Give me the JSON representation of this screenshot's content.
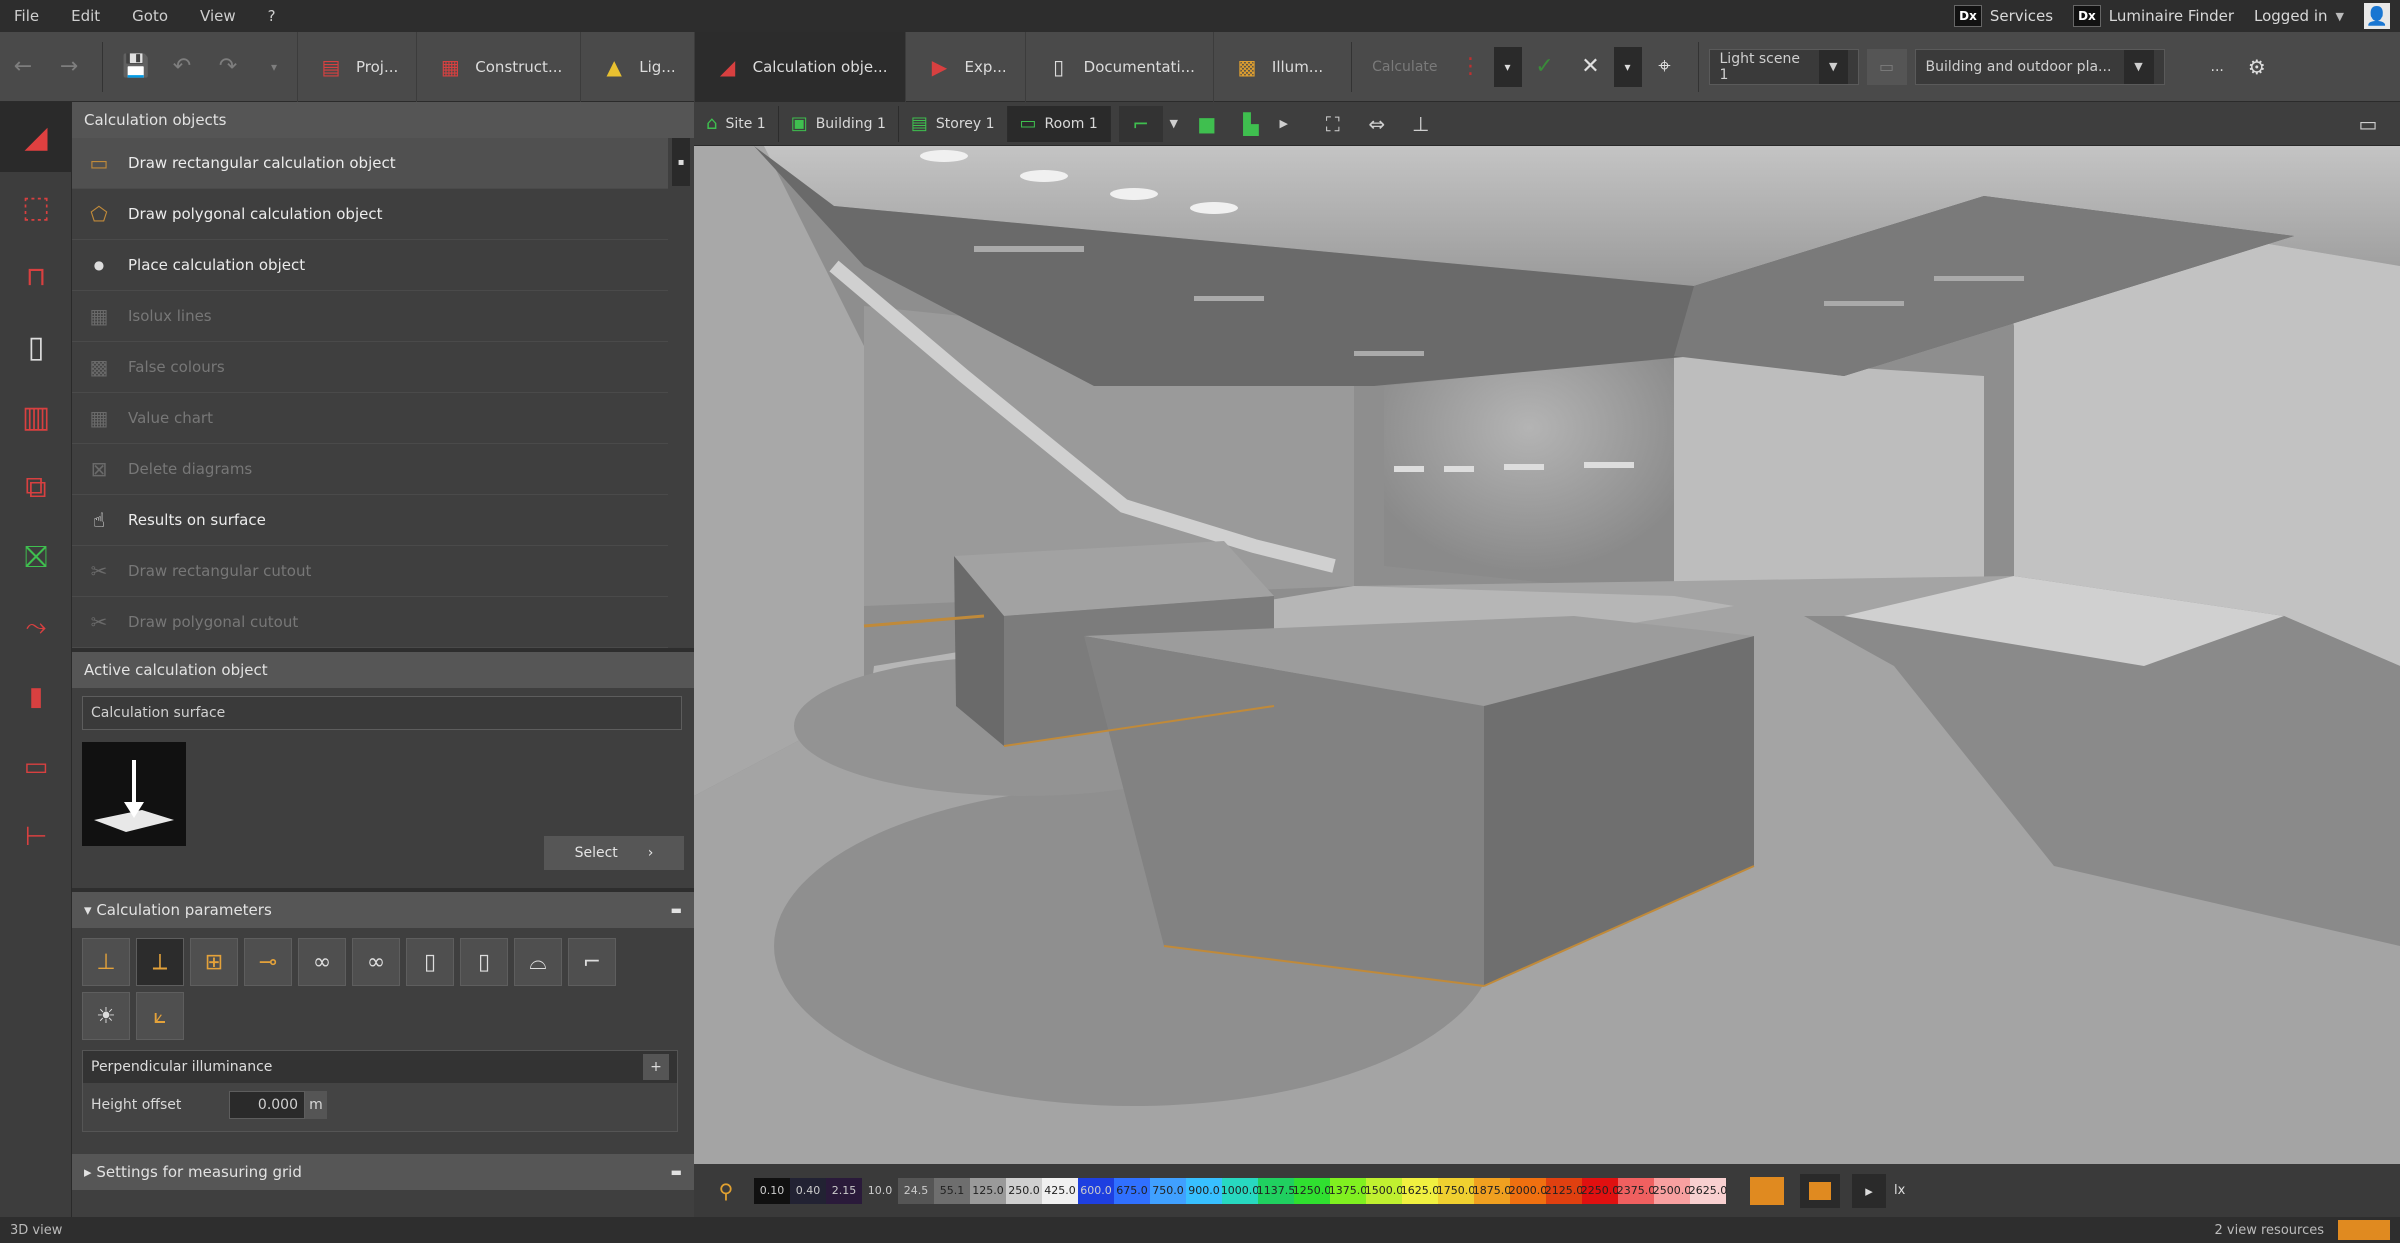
{
  "menu": [
    "File",
    "Edit",
    "Goto",
    "View",
    "?"
  ],
  "top_right": {
    "services": "Services",
    "luminaire_finder": "Luminaire Finder",
    "logged_in": "Logged in"
  },
  "toolbar": {
    "tabs": [
      {
        "label": "Proj...",
        "icon": "project-icon"
      },
      {
        "label": "Construct...",
        "icon": "construction-icon"
      },
      {
        "label": "Lig...",
        "icon": "light-icon"
      },
      {
        "label": "Calculation obje...",
        "icon": "calculation-objects-icon",
        "active": true
      },
      {
        "label": "Exp...",
        "icon": "export-icon"
      },
      {
        "label": "Documentati...",
        "icon": "documentation-icon"
      },
      {
        "label": "Illum...",
        "icon": "illumination-icon"
      }
    ],
    "calculate_label": "Calculate",
    "light_scene": "Light scene 1",
    "view_mode": "Building and outdoor pla...",
    "more": "..."
  },
  "panel": {
    "title": "Calculation objects",
    "items": [
      {
        "label": "Draw rectangular calculation object",
        "enabled": true
      },
      {
        "label": "Draw polygonal calculation object",
        "enabled": true
      },
      {
        "label": "Place calculation object",
        "enabled": true
      },
      {
        "label": "Isolux lines",
        "enabled": false
      },
      {
        "label": "False colours",
        "enabled": false
      },
      {
        "label": "Value chart",
        "enabled": false
      },
      {
        "label": "Delete diagrams",
        "enabled": false
      },
      {
        "label": "Results on surface",
        "enabled": true
      },
      {
        "label": "Draw rectangular cutout",
        "enabled": false
      },
      {
        "label": "Draw polygonal cutout",
        "enabled": false
      }
    ],
    "active_section": "Active calculation object",
    "active_name": "Calculation surface",
    "select_label": "Select",
    "params_section": "Calculation parameters",
    "param_type": "Perpendicular illuminance",
    "height_offset_label": "Height offset",
    "height_offset_value": "0.000",
    "height_offset_unit": "m",
    "grid_section": "Settings for measuring grid"
  },
  "breadcrumb": [
    {
      "label": "Site 1"
    },
    {
      "label": "Building 1"
    },
    {
      "label": "Storey 1"
    },
    {
      "label": "Room 1"
    }
  ],
  "legend": {
    "values": [
      "0.10",
      "0.40",
      "2.15",
      "10.0",
      "24.5",
      "55.1",
      "125.0",
      "250.0",
      "425.0",
      "600.0",
      "675.0",
      "750.0",
      "900.0",
      "1000.0",
      "1137.5",
      "1250.0",
      "1375.0",
      "1500.0",
      "1625.0",
      "1750.0",
      "1875.0",
      "2000.0",
      "2125.0",
      "2250.0",
      "2375.0",
      "2500.0",
      "2625.0"
    ],
    "colors": [
      "#101010",
      "#222233",
      "#2a1a3a",
      "#3a3a3a",
      "#555555",
      "#6e6e6e",
      "#9a9a9a",
      "#cfcfcf",
      "#f0f0f0",
      "#1e3fe0",
      "#3070ff",
      "#40a0ff",
      "#38c0ff",
      "#28d8c0",
      "#20d060",
      "#30e030",
      "#80f020",
      "#c0f030",
      "#f0f040",
      "#f0d030",
      "#f0a020",
      "#f07010",
      "#e04010",
      "#e01010",
      "#f06060",
      "#f8a0a0",
      "#f8d0d0"
    ],
    "unit": "lx"
  },
  "status": {
    "left": "3D view",
    "right": "2 view resources"
  }
}
